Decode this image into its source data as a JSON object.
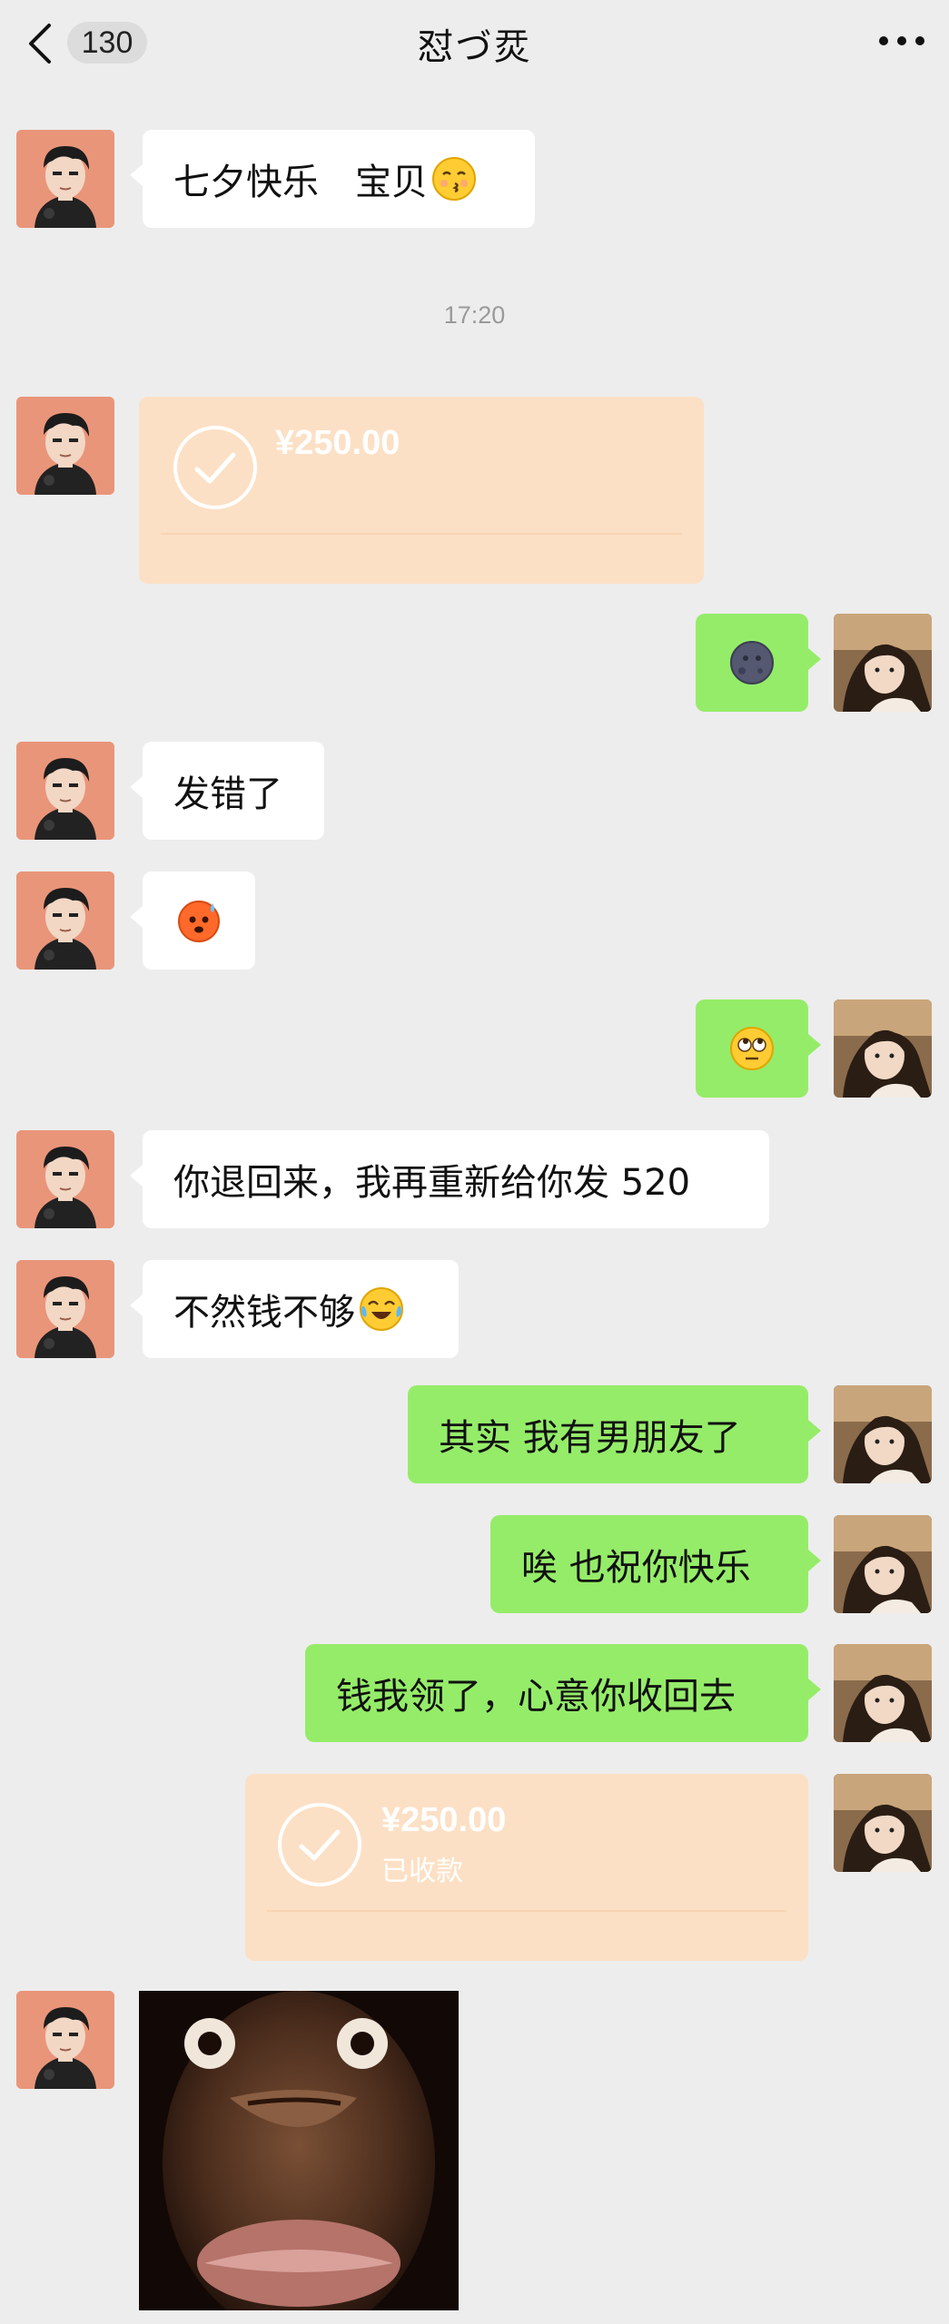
{
  "header": {
    "back_icon": "chevron-left-icon",
    "unread_count": "130",
    "title": "怼づ烎",
    "more_icon": "ellipsis-icon"
  },
  "timestamp": "17:20",
  "messages": {
    "m1": "七夕快乐　宝贝",
    "m1_emoji": "kissing-face-emoji",
    "t1_amount": "¥250.00",
    "m3_emoji": "new-moon-face-emoji",
    "m4": "发错了",
    "m5_emoji": "angry-sweat-face-emoji",
    "m6_emoji": "rolling-eyes-emoji",
    "m7": "你退回来，我再重新给你发 520",
    "m8": "不然钱不够",
    "m8_emoji": "crying-laughing-emoji",
    "m9": "其实 我有男朋友了",
    "m10": "唉 也祝你快乐",
    "m11": "钱我领了，心意你收回去",
    "t2_amount": "¥250.00",
    "t2_status": "已收款",
    "sticker": "staring-monkey-sticker"
  },
  "colors": {
    "background": "#ededed",
    "bubble_left": "#ffffff",
    "bubble_right": "#95ec69",
    "transfer": "#fce0c5"
  }
}
